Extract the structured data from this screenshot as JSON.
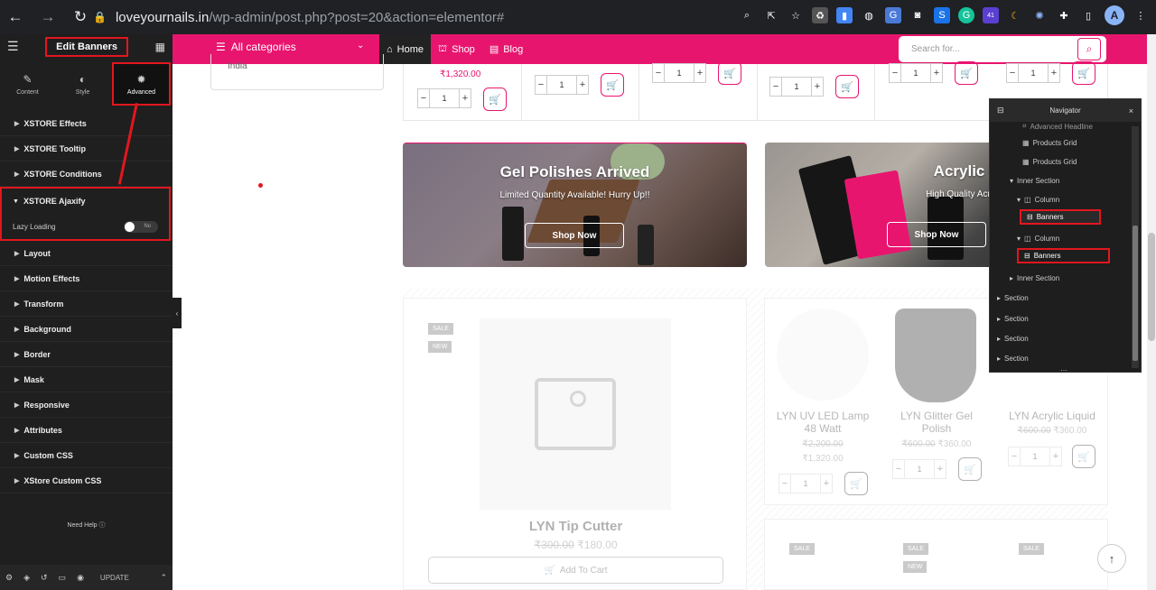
{
  "browser": {
    "url_host": "loveyournails.in",
    "url_path": "/wp-admin/post.php?post=20&action=elementor#",
    "profile_initial": "A",
    "extension_badge": "41"
  },
  "panel": {
    "title": "Edit Banners",
    "tabs": [
      {
        "label": "Content",
        "icon": "pencil-icon"
      },
      {
        "label": "Style",
        "icon": "contrast-icon"
      },
      {
        "label": "Advanced",
        "icon": "gear-icon"
      }
    ],
    "sections_top": [
      "XSTORE Effects",
      "XSTORE Tooltip",
      "XSTORE Conditions"
    ],
    "ajaxify": {
      "label": "XSTORE Ajaxify",
      "lazy_label": "Lazy Loading",
      "toggle": "No"
    },
    "sections_bottom": [
      "Layout",
      "Motion Effects",
      "Transform",
      "Background",
      "Border",
      "Mask",
      "Responsive",
      "Attributes",
      "Custom CSS",
      "XStore Custom CSS"
    ],
    "need_help": "Need Help",
    "update": "UPDATE"
  },
  "header": {
    "categories": "All categories",
    "menu": [
      "Home",
      "Shop",
      "Blog"
    ],
    "search_placeholder": "Search for..."
  },
  "canvas": {
    "india": "India",
    "top_prices": [
      "₹1,320.00"
    ],
    "qty": "1",
    "banners": [
      {
        "title": "Gel Polishes Arrived",
        "subtitle": "Limited Quantity Available! Hurry Up!!",
        "button": "Shop Now"
      },
      {
        "title": "Acrylic Product",
        "subtitle": "High Quality Acrylic Products for",
        "button": "Shop Now"
      }
    ],
    "big_product": {
      "badges": [
        "SALE",
        "NEW"
      ],
      "name": "LYN Tip Cutter",
      "old_price": "₹300.00",
      "price": "₹180.00",
      "button": "Add To Cart"
    },
    "products": [
      {
        "name": "LYN UV LED Lamp 48 Watt",
        "old_price": "₹2,200.00",
        "price": "₹1,320.00"
      },
      {
        "name": "LYN Glitter Gel Polish",
        "old_price": "₹600.00",
        "price": "₹360.00"
      },
      {
        "name": "LYN Acrylic Liquid",
        "old_price": "₹600.00",
        "price": "₹360.00"
      }
    ],
    "bottom_badges": [
      "SALE",
      "SALE",
      "NEW",
      "SALE"
    ]
  },
  "navigator": {
    "title": "Navigator",
    "items": [
      "Advanced Headline",
      "Products Grid",
      "Products Grid",
      "Inner Section",
      "Column",
      "Banners",
      "Column",
      "Banners",
      "Inner Section",
      "Section",
      "Section",
      "Section",
      "Section"
    ]
  }
}
